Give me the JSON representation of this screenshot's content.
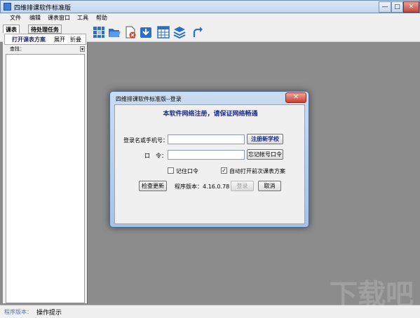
{
  "window": {
    "title": "四维排课软件标准版",
    "min": "—",
    "max": "□",
    "close": "✕"
  },
  "menu": [
    "文件",
    "编辑",
    "课表窗口",
    "工具",
    "帮助"
  ],
  "toolbar": {
    "icons": [
      "grid-select-icon",
      "open-folder-icon",
      "delete-document-icon",
      "download-icon",
      "table-icon",
      "layers-icon",
      "redo-arrow-icon"
    ],
    "colors": {
      "blue": "#2a6fc9",
      "red": "#d83a2a"
    }
  },
  "left": {
    "tabs": [
      "课表",
      "待处理任务"
    ],
    "subtabs": [
      "打开课表方案",
      "展开",
      "折叠"
    ],
    "search_label": "查找：",
    "search_drop": "▾"
  },
  "status": {
    "version_label": "程序版本：",
    "tip": "操作提示"
  },
  "dialog": {
    "title": "四维排课软件标准版--登录",
    "close": "✕",
    "heading": "本软件网络注册，请保证网络畅通",
    "user_label": "登录名或手机号：",
    "user_value": "",
    "register_button": "注册新学校",
    "password_label": "口　令：",
    "password_value": "",
    "forgot_button": "忘记帐号口令",
    "remember_label": "记住口令",
    "remember_checked": false,
    "autoopen_label": "自动打开前次课表方案",
    "autoopen_checked": true,
    "check_update_button": "检查更新",
    "version_text": "程序版本：4.16.0.78",
    "login_button": "登录",
    "cancel_button": "取消"
  },
  "watermark": "下载吧"
}
